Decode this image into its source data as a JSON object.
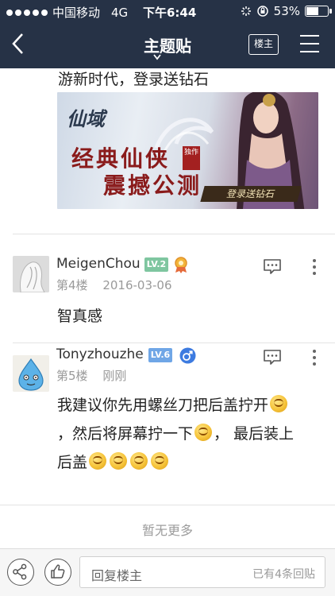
{
  "status_bar": {
    "carrier": "中国移动",
    "network": "4G",
    "time": "下午6:44",
    "battery_text": "53%",
    "battery_level": 0.53
  },
  "nav": {
    "title": "主题贴",
    "louzhu_button": "楼主",
    "back_icon": "chevron-left-icon",
    "menu_icon": "hamburger-menu-icon"
  },
  "ad": {
    "caption": "游新时代，登录送钻石",
    "logo_text": "仙域",
    "slogan_line1": "经典仙侠",
    "slogan_line2": "震撼公测",
    "stamp_text": "独作",
    "cta_text": "登录送钻石"
  },
  "posts": [
    {
      "username": "MeigenChou",
      "level": "LV.2",
      "level_color": "#7fc6a0",
      "floor": "第4楼",
      "time": "2016-03-06",
      "text": "智真感"
    },
    {
      "username": "Tonyzhouzhe",
      "level": "LV.6",
      "level_color": "#6fa6e6",
      "floor": "第5楼",
      "time": "刚刚",
      "text_part1": "我建议你先用螺丝刀把后盖拧开",
      "text_part2": "，然后将屏幕拧一下",
      "text_part3": "， 最后装上",
      "text_part4": "后盖"
    }
  ],
  "footer": {
    "no_more": "暂无更多"
  },
  "bottom_bar": {
    "reply_placeholder": "回复楼主",
    "reply_count": "已有4条回贴",
    "share_icon": "share-icon",
    "like_icon": "thumbs-up-icon"
  },
  "colors": {
    "nav_bg": "#263246",
    "gender_male": "#3d7be0"
  }
}
